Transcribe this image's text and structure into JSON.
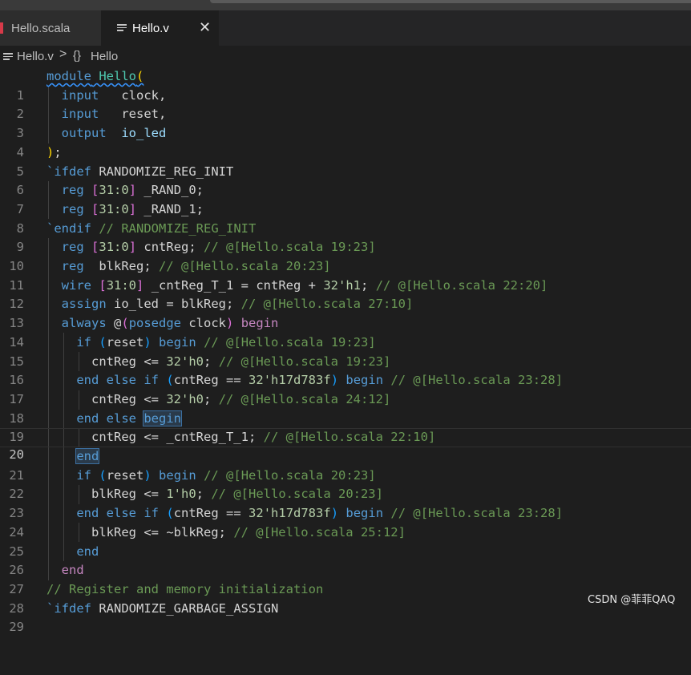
{
  "tabs": [
    {
      "label": "Hello.scala",
      "active": false,
      "icon": "scala-icon"
    },
    {
      "label": "Hello.v",
      "active": true,
      "icon": "lines-icon",
      "close": "✕"
    }
  ],
  "breadcrumb": {
    "file": "Hello.v",
    "separator": ">",
    "symbol_icon": "{}",
    "symbol": "Hello"
  },
  "editor": {
    "current_line": 20,
    "lines": [
      {
        "n": "1"
      },
      {
        "n": "2"
      },
      {
        "n": "3"
      },
      {
        "n": "4"
      },
      {
        "n": "5"
      },
      {
        "n": "6"
      },
      {
        "n": "7"
      },
      {
        "n": "8"
      },
      {
        "n": "9"
      },
      {
        "n": "10"
      },
      {
        "n": "11"
      },
      {
        "n": "12"
      },
      {
        "n": "13"
      },
      {
        "n": "14"
      },
      {
        "n": "15"
      },
      {
        "n": "16"
      },
      {
        "n": "17"
      },
      {
        "n": "18"
      },
      {
        "n": "19"
      },
      {
        "n": "20"
      },
      {
        "n": "21"
      },
      {
        "n": "22"
      },
      {
        "n": "23"
      },
      {
        "n": "24"
      },
      {
        "n": "25"
      },
      {
        "n": "26"
      },
      {
        "n": "27"
      },
      {
        "n": "28"
      },
      {
        "n": "29"
      }
    ],
    "tokens": {
      "module_kw": "module",
      "module_name": " Hello",
      "open_paren": "(",
      "input": "input",
      "output": "output",
      "clock_port": "   clock,",
      "reset_port": "   reset,",
      "io_led_port": "  io_led",
      "close_paren": ")",
      "semi": ";",
      "tick": "`",
      "ifdef": "ifdef",
      "endif": "endif",
      "randomize_reg_init": " RANDOMIZE_REG_INIT",
      "endif_comment": " // RANDOMIZE_REG_INIT",
      "reg": "reg",
      "wire": "wire",
      "assign": "assign",
      "always": "always",
      "lb": "[",
      "rb": "]",
      "range": "31:0",
      "rand0": " _RAND_0;",
      "rand1": " _RAND_1;",
      "cntreg_decl": " cntReg; ",
      "c_h1923": "// @[Hello.scala 19:23]",
      "blkreg_decl": "  blkReg; ",
      "c_h2023": "// @[Hello.scala 20:23]",
      "cnt_t1_decl": " _cntReg_T_1 = cntReg + ",
      "v_32h1": "32'h1",
      "c_h2220": "// @[Hello.scala 22:20]",
      "assign_body": " io_led = blkReg; ",
      "c_h2710": "// @[Hello.scala 27:10]",
      "at": " @",
      "posedge": "posedge",
      "clock": " clock",
      "begin": "begin",
      "if": "if",
      "else": "else",
      "end": "end",
      "reset": "reset",
      "cnt_assign": "cntReg <= ",
      "v_32h0": "32'h0",
      "cnt_eq": "cntReg == ",
      "v_32h17": "32'h17d783f",
      "c_h2328": "// @[Hello.scala 23:28]",
      "c_h2412": "// @[Hello.scala 24:12]",
      "cnt_t1_assign": "cntReg <= _cntReg_T_1; ",
      "c_h2210": "// @[Hello.scala 22:10]",
      "blk_assign": "blkReg <= ",
      "v_1h0": "1'h0",
      "blk_eq_label": "cntReg == ",
      "blk_not": "blkReg <= ~blkReg; ",
      "c_h2512": "// @[Hello.scala 25:12]",
      "comment_reg_mem": "// Register and memory initialization",
      "randomize_garbage": " RANDOMIZE_GARBAGE_ASSIGN"
    }
  },
  "watermark": "CSDN @菲菲QAQ"
}
